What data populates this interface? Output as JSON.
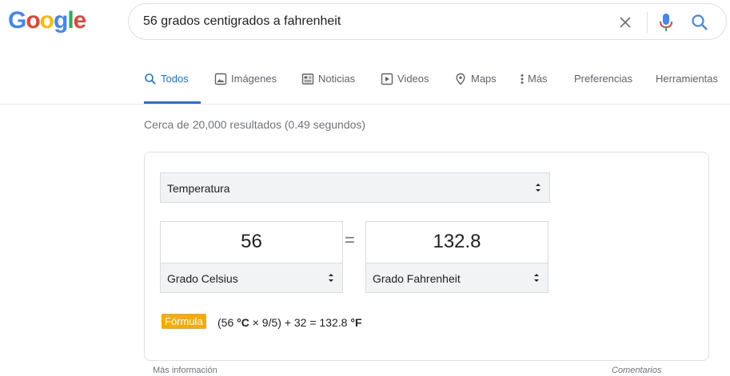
{
  "logo": {
    "text": "Google",
    "letters": [
      "G",
      "o",
      "o",
      "g",
      "l",
      "e"
    ]
  },
  "search": {
    "query": "56 grados centigrados a fahrenheit"
  },
  "tabs": [
    {
      "label": "Todos",
      "icon": "search-icon",
      "active": true
    },
    {
      "label": "Imágenes",
      "icon": "image-icon"
    },
    {
      "label": "Noticias",
      "icon": "news-icon"
    },
    {
      "label": "Videos",
      "icon": "video-icon"
    },
    {
      "label": "Maps",
      "icon": "map-pin-icon"
    },
    {
      "label": "Más",
      "icon": "more-vert-icon"
    },
    {
      "label": "Preferencias"
    },
    {
      "label": "Herramientas"
    }
  ],
  "stats": "Cerca de 20,000 resultados (0.49 segundos)",
  "converter": {
    "category": "Temperatura",
    "from_value": "56",
    "from_unit": "Grado Celsius",
    "equals": "=",
    "to_value": "132.8",
    "to_unit": "Grado Fahrenheit",
    "formula_label": "Fórmula",
    "formula": {
      "pre": "(56 ",
      "u1": "°C",
      "mid": " × 9/5) + 32 = 132.8 ",
      "u2": "°F"
    }
  },
  "footer": {
    "more_info": "Más información",
    "feedback": "Comentarios"
  },
  "colors": {
    "accent": "#1a73e8",
    "mic_red": "#ea4335",
    "formula_badge": "#f9ab00"
  }
}
